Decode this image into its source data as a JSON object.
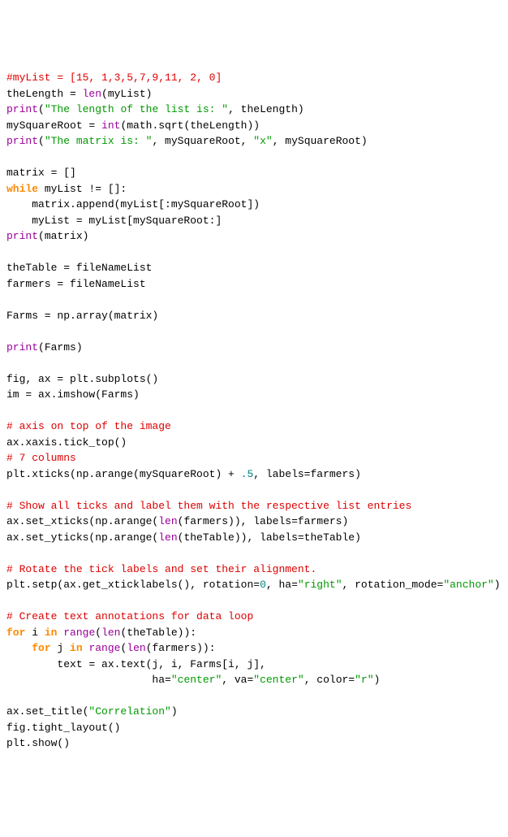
{
  "lines": [
    [
      {
        "cls": "comment",
        "t": "#myList = [15, 1,3,5,7,9,11, 2, 0]"
      }
    ],
    [
      {
        "cls": "text",
        "t": "theLength = "
      },
      {
        "cls": "builtin",
        "t": "len"
      },
      {
        "cls": "text",
        "t": "(myList)"
      }
    ],
    [
      {
        "cls": "builtin",
        "t": "print"
      },
      {
        "cls": "text",
        "t": "("
      },
      {
        "cls": "string",
        "t": "\"The length of the list is: \""
      },
      {
        "cls": "text",
        "t": ", theLength)"
      }
    ],
    [
      {
        "cls": "text",
        "t": "mySquareRoot = "
      },
      {
        "cls": "builtin",
        "t": "int"
      },
      {
        "cls": "text",
        "t": "(math.sqrt(theLength))"
      }
    ],
    [
      {
        "cls": "builtin",
        "t": "print"
      },
      {
        "cls": "text",
        "t": "("
      },
      {
        "cls": "string",
        "t": "\"The matrix is: \""
      },
      {
        "cls": "text",
        "t": ", mySquareRoot, "
      },
      {
        "cls": "string",
        "t": "\"x\""
      },
      {
        "cls": "text",
        "t": ", mySquareRoot)"
      }
    ],
    [
      {
        "cls": "text",
        "t": " "
      }
    ],
    [
      {
        "cls": "text",
        "t": "matrix = []"
      }
    ],
    [
      {
        "cls": "keyword",
        "t": "while"
      },
      {
        "cls": "text",
        "t": " myList != []:"
      }
    ],
    [
      {
        "cls": "text",
        "t": "    matrix.append(myList[:mySquareRoot])"
      }
    ],
    [
      {
        "cls": "text",
        "t": "    myList = myList[mySquareRoot:]"
      }
    ],
    [
      {
        "cls": "builtin",
        "t": "print"
      },
      {
        "cls": "text",
        "t": "(matrix)"
      }
    ],
    [
      {
        "cls": "text",
        "t": " "
      }
    ],
    [
      {
        "cls": "text",
        "t": "theTable = fileNameList"
      }
    ],
    [
      {
        "cls": "text",
        "t": "farmers = fileNameList"
      }
    ],
    [
      {
        "cls": "text",
        "t": " "
      }
    ],
    [
      {
        "cls": "text",
        "t": "Farms = np.array(matrix)"
      }
    ],
    [
      {
        "cls": "text",
        "t": " "
      }
    ],
    [
      {
        "cls": "builtin",
        "t": "print"
      },
      {
        "cls": "text",
        "t": "(Farms)"
      }
    ],
    [
      {
        "cls": "text",
        "t": " "
      }
    ],
    [
      {
        "cls": "text",
        "t": "fig, ax = plt.subplots()"
      }
    ],
    [
      {
        "cls": "text",
        "t": "im = ax.imshow(Farms)"
      }
    ],
    [
      {
        "cls": "text",
        "t": " "
      }
    ],
    [
      {
        "cls": "comment",
        "t": "# axis on top of the image"
      }
    ],
    [
      {
        "cls": "text",
        "t": "ax.xaxis.tick_top()"
      }
    ],
    [
      {
        "cls": "comment",
        "t": "# 7 columns"
      }
    ],
    [
      {
        "cls": "text",
        "t": "plt.xticks(np.arange(mySquareRoot) + "
      },
      {
        "cls": "number",
        "t": ".5"
      },
      {
        "cls": "text",
        "t": ", labels=farmers)"
      }
    ],
    [
      {
        "cls": "text",
        "t": " "
      }
    ],
    [
      {
        "cls": "comment",
        "t": "# Show all ticks and label them with the respective list entries"
      }
    ],
    [
      {
        "cls": "text",
        "t": "ax.set_xticks(np.arange("
      },
      {
        "cls": "builtin",
        "t": "len"
      },
      {
        "cls": "text",
        "t": "(farmers)), labels=farmers)"
      }
    ],
    [
      {
        "cls": "text",
        "t": "ax.set_yticks(np.arange("
      },
      {
        "cls": "builtin",
        "t": "len"
      },
      {
        "cls": "text",
        "t": "(theTable)), labels=theTable)"
      }
    ],
    [
      {
        "cls": "text",
        "t": " "
      }
    ],
    [
      {
        "cls": "comment",
        "t": "# Rotate the tick labels and set their alignment."
      }
    ],
    [
      {
        "cls": "text",
        "t": "plt.setp(ax.get_xticklabels(), rotation="
      },
      {
        "cls": "number",
        "t": "0"
      },
      {
        "cls": "text",
        "t": ", ha="
      },
      {
        "cls": "string",
        "t": "\"right\""
      },
      {
        "cls": "text",
        "t": ", rotation_mode="
      },
      {
        "cls": "string",
        "t": "\"anchor\""
      },
      {
        "cls": "text",
        "t": ")"
      }
    ],
    [
      {
        "cls": "text",
        "t": " "
      }
    ],
    [
      {
        "cls": "comment",
        "t": "# Create text annotations for data loop"
      }
    ],
    [
      {
        "cls": "keyword",
        "t": "for"
      },
      {
        "cls": "text",
        "t": " i "
      },
      {
        "cls": "keyword",
        "t": "in"
      },
      {
        "cls": "text",
        "t": " "
      },
      {
        "cls": "builtin",
        "t": "range"
      },
      {
        "cls": "text",
        "t": "("
      },
      {
        "cls": "builtin",
        "t": "len"
      },
      {
        "cls": "text",
        "t": "(theTable)):"
      }
    ],
    [
      {
        "cls": "text",
        "t": "    "
      },
      {
        "cls": "keyword",
        "t": "for"
      },
      {
        "cls": "text",
        "t": " j "
      },
      {
        "cls": "keyword",
        "t": "in"
      },
      {
        "cls": "text",
        "t": " "
      },
      {
        "cls": "builtin",
        "t": "range"
      },
      {
        "cls": "text",
        "t": "("
      },
      {
        "cls": "builtin",
        "t": "len"
      },
      {
        "cls": "text",
        "t": "(farmers)):"
      }
    ],
    [
      {
        "cls": "text",
        "t": "        text = ax.text(j, i, Farms[i, j],"
      }
    ],
    [
      {
        "cls": "text",
        "t": "                       ha="
      },
      {
        "cls": "string",
        "t": "\"center\""
      },
      {
        "cls": "text",
        "t": ", va="
      },
      {
        "cls": "string",
        "t": "\"center\""
      },
      {
        "cls": "text",
        "t": ", color="
      },
      {
        "cls": "string",
        "t": "\"r\""
      },
      {
        "cls": "text",
        "t": ")"
      }
    ],
    [
      {
        "cls": "text",
        "t": " "
      }
    ],
    [
      {
        "cls": "text",
        "t": "ax.set_title("
      },
      {
        "cls": "string",
        "t": "\"Correlation\""
      },
      {
        "cls": "text",
        "t": ")"
      }
    ],
    [
      {
        "cls": "text",
        "t": "fig.tight_layout()"
      }
    ],
    [
      {
        "cls": "text",
        "t": "plt.show()"
      }
    ]
  ]
}
